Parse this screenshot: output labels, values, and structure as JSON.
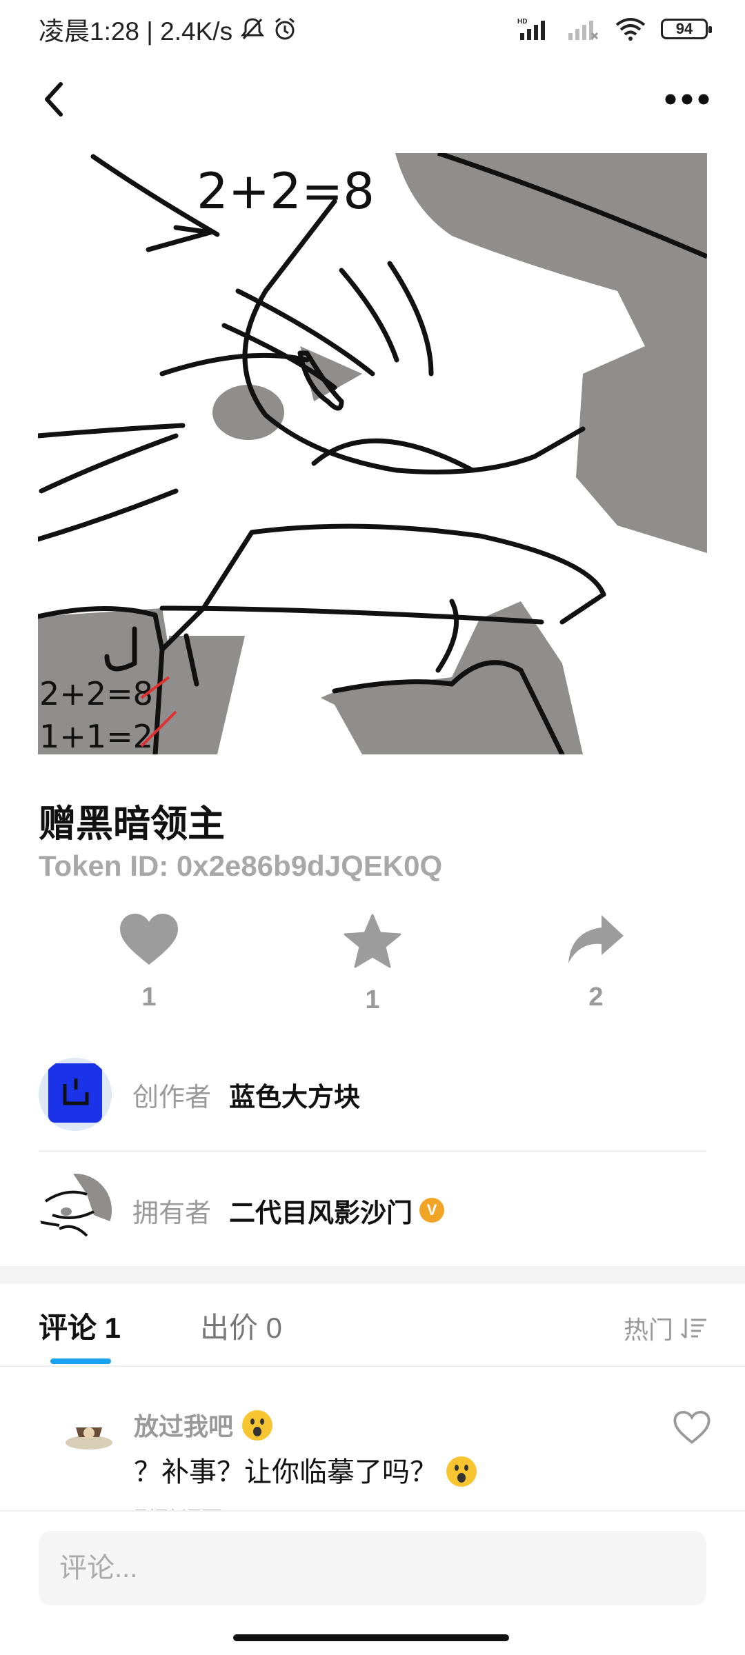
{
  "status_bar": {
    "time_text": "凌晨1:28 | 2.4K/s",
    "battery": "94",
    "icons": [
      "mute-icon",
      "alarm-icon",
      "hd-signal-icon",
      "signal-icon",
      "wifi-icon",
      "battery-icon"
    ]
  },
  "nav": {
    "back_icon": "chevron-left-icon",
    "more_icon": "more-horizontal-icon"
  },
  "artwork": {
    "texts": [
      "2+2=8",
      "2+2=8",
      "1+1=2"
    ]
  },
  "nft": {
    "title": "赠黑暗领主",
    "token_id": "Token ID: 0x2e86b9dJQEK0Q"
  },
  "actions": [
    {
      "icon": "heart-icon",
      "count": "1"
    },
    {
      "icon": "star-icon",
      "count": "1"
    },
    {
      "icon": "share-icon",
      "count": "2"
    }
  ],
  "creator": {
    "role": "创作者",
    "name": "蓝色大方块"
  },
  "owner": {
    "role": "拥有者",
    "name": "二代目风影沙门",
    "badge": "V"
  },
  "tabs": [
    {
      "label": "评论 1"
    },
    {
      "label": "出价 0"
    }
  ],
  "sort": {
    "label": "热门"
  },
  "comments": [
    {
      "author": "放过我吧",
      "text": "？补事？让你临摹了吗？",
      "time": "刚刚  评要"
    }
  ],
  "comment_input": {
    "placeholder": "评论..."
  },
  "colors": {
    "accent": "#1aa1f0",
    "verified": "#f2a427",
    "muted": "#999999",
    "sketch_gray": "#908e8c"
  }
}
